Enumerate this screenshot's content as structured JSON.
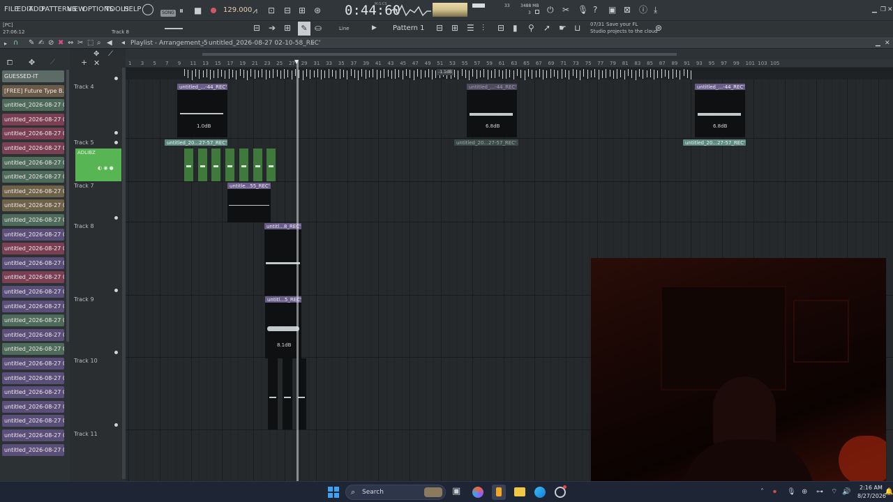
{
  "menu": {
    "items": [
      "FILE",
      "EDIT",
      "ADD",
      "PATTERNS",
      "VIEW",
      "OPTIONS",
      "TOOLS",
      "HELP"
    ]
  },
  "transport": {
    "mode": "SONG",
    "tempo": "129.000",
    "time": "0:44:60",
    "time_label": "M:S:CS",
    "memory": "3488 MB",
    "cpu": "33",
    "voices": "3",
    "pc_label": "[PC]",
    "pc_time": "27:06:12",
    "track_hint": "Track 8"
  },
  "toolbar": {
    "snap": "Line",
    "pattern": "Pattern 1",
    "news_count": "07/31",
    "news_line1": "Save your FL",
    "news_line2": "Studio projects to the cloud"
  },
  "playlist": {
    "title": "Playlist - Arrangement_5",
    "breadcrumb": "untitled_2026-08-27 02-10-58_REC'"
  },
  "ruler": {
    "marks": [
      "1",
      "3",
      "5",
      "7",
      "9",
      "11",
      "13",
      "15",
      "17",
      "19",
      "21",
      "23",
      "25",
      "27",
      "29",
      "31",
      "33",
      "35",
      "37",
      "39",
      "41",
      "43",
      "45",
      "47",
      "49",
      "51",
      "53",
      "55",
      "57",
      "59",
      "61",
      "63",
      "65",
      "67",
      "69",
      "71",
      "73",
      "75",
      "77",
      "79",
      "81",
      "83",
      "85",
      "87",
      "89",
      "91",
      "93",
      "95",
      "97",
      "99",
      "101",
      "103",
      "105"
    ],
    "gain": "-1.1dB"
  },
  "browser": {
    "items": [
      {
        "label": "GUESSED-IT",
        "color": "#5c6b66"
      },
      {
        "label": "[FREE] Future Type B...",
        "color": "#6a5a48"
      },
      {
        "label": "untitled_2026-08-27 01-...",
        "color": "#4d6a5a"
      },
      {
        "label": "untitled_2026-08-27 01-...",
        "color": "#7a3f52"
      },
      {
        "label": "untitled_2026-08-27 01-...",
        "color": "#7a3f52"
      },
      {
        "label": "untitled_2026-08-27 01-...",
        "color": "#7a3f52"
      },
      {
        "label": "untitled_2026-08-27 01-...",
        "color": "#4d6a5a"
      },
      {
        "label": "untitled_2026-08-27 01-...",
        "color": "#4d6a5a"
      },
      {
        "label": "untitled_2026-08-27 01-...",
        "color": "#6e6248"
      },
      {
        "label": "untitled_2026-08-27 01-...",
        "color": "#6e6248"
      },
      {
        "label": "untitled_2026-08-27 01-...",
        "color": "#4d6a5a"
      },
      {
        "label": "untitled_2026-08-27 01-...",
        "color": "#5a4f78"
      },
      {
        "label": "untitled_2026-08-27 01-...",
        "color": "#7a3f52"
      },
      {
        "label": "untitled_2026-08-27 01-...",
        "color": "#5a4f78"
      },
      {
        "label": "untitled_2026-08-27 01-...",
        "color": "#7a3f52"
      },
      {
        "label": "untitled_2026-08-27 01-...",
        "color": "#5a4f78"
      },
      {
        "label": "untitled_2026-08-27 01-...",
        "color": "#5a4f78"
      },
      {
        "label": "untitled_2026-08-27 01-...",
        "color": "#4d6a5a"
      },
      {
        "label": "untitled_2026-08-27 02-...",
        "color": "#5a4f78"
      },
      {
        "label": "untitled_2026-08-27 02-...",
        "color": "#4d6a5a"
      },
      {
        "label": "untitled_2026-08-27 02-...",
        "color": "#5a4f78"
      },
      {
        "label": "untitled_2026-08-27 02-...",
        "color": "#5a4f78"
      },
      {
        "label": "untitled_2026-08-27 02-...",
        "color": "#5a4f78"
      },
      {
        "label": "untitled_2026-08-27 02-...",
        "color": "#5a4f78"
      },
      {
        "label": "untitled_2026-08-27 02-...",
        "color": "#5a4f78"
      },
      {
        "label": "untitled_2026-08-27 02-...",
        "color": "#5a4f78"
      },
      {
        "label": "untitled_2026-08-27 02-...",
        "color": "#5a4f78"
      }
    ]
  },
  "tracks": {
    "t4": "Track 4",
    "t5": "Track 5",
    "t6": "ADLIBZ",
    "t7": "Track 7",
    "t8": "Track 8",
    "t9": "Track 9",
    "t10": "Track 10",
    "t11": "Track 11"
  },
  "clips": {
    "c1": "untitled_...-44_REC'",
    "c2": "untitled_...-44_REC'",
    "c3": "untitled_...-44_REC'",
    "g1": "1.0dB",
    "g2": "6.8dB",
    "g3": "6.8dB",
    "c4": "untitled_20...27-57_REC'",
    "c5": "untitled_20...27-57_REC'",
    "c6": "untitled_20...27-57_REC'",
    "c7": "untitle...55_REC'",
    "c8": "untitl...8_REC'",
    "c9": "untitl...5_REC'",
    "g9": "8.1dB"
  },
  "taskbar": {
    "search": "Search",
    "time": "2:16 AM",
    "date": "8/27/2026"
  }
}
